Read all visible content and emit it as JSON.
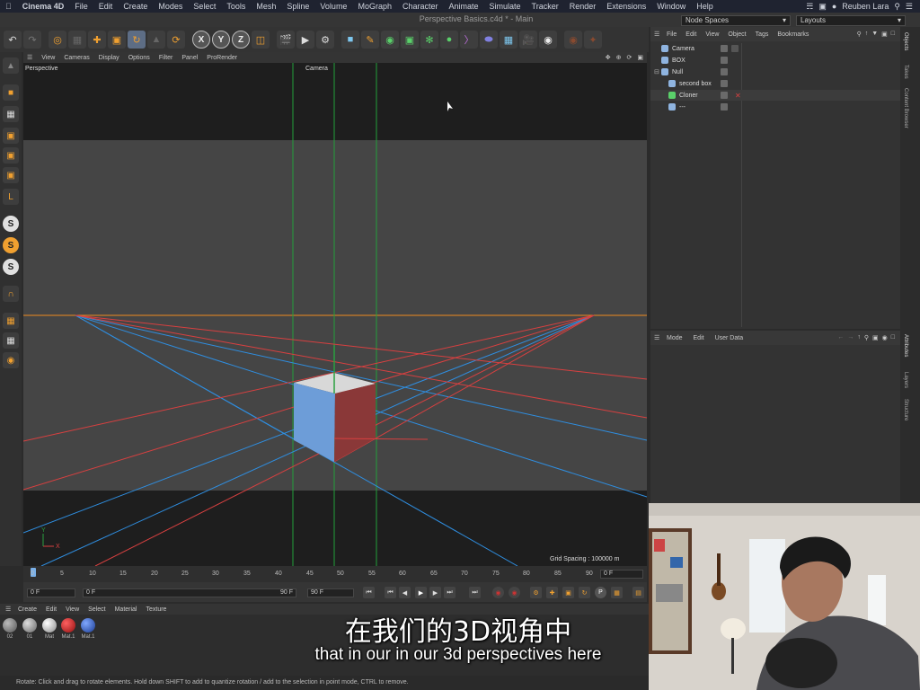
{
  "menubar": {
    "app_name": "Cinema 4D",
    "items": [
      "File",
      "Edit",
      "Create",
      "Modes",
      "Select",
      "Tools",
      "Mesh",
      "Spline",
      "Volume",
      "MoGraph",
      "Character",
      "Animate",
      "Simulate",
      "Tracker",
      "Render",
      "Extensions",
      "Window",
      "Help"
    ],
    "user": "Reuben Lara"
  },
  "window": {
    "title": "Perspective Basics.c4d * - Main",
    "node_spaces": "Node Spaces",
    "layouts": "Layouts"
  },
  "viewport": {
    "menu": [
      "View",
      "Cameras",
      "Display",
      "Options",
      "Filter",
      "Panel",
      "ProRender"
    ],
    "label": "Perspective",
    "camera": "Camera",
    "grid_spacing": "Grid Spacing : 100000 m",
    "axis_y": "Y",
    "axis_x": "X"
  },
  "timeline": {
    "ticks": [
      "0",
      "5",
      "10",
      "15",
      "20",
      "25",
      "30",
      "35",
      "40",
      "45",
      "50",
      "55",
      "60",
      "65",
      "70",
      "75",
      "80",
      "85",
      "90"
    ],
    "current_frame": "0 F"
  },
  "transport": {
    "start": "0 F",
    "current": "0 F",
    "end": "90 F",
    "end2": "90 F"
  },
  "object_manager": {
    "menu": [
      "File",
      "Edit",
      "View",
      "Object",
      "Tags",
      "Bookmarks"
    ],
    "objects": [
      {
        "name": "Camera",
        "indent": 0
      },
      {
        "name": "BOX",
        "indent": 0
      },
      {
        "name": "Null",
        "indent": 0
      },
      {
        "name": "second box",
        "indent": 1
      },
      {
        "name": "Cloner",
        "indent": 1
      },
      {
        "name": "---",
        "indent": 1
      }
    ]
  },
  "attribute_manager": {
    "menu": [
      "Mode",
      "Edit",
      "User Data"
    ]
  },
  "side_tabs": [
    "Objects",
    "Takes",
    "Content Browser",
    "Attributes",
    "Layers",
    "Structure"
  ],
  "material_manager": {
    "menu": [
      "Create",
      "Edit",
      "View",
      "Select",
      "Material",
      "Texture"
    ],
    "materials": [
      {
        "name": "02",
        "color": "#888888"
      },
      {
        "name": "01",
        "color": "#aaaaaa"
      },
      {
        "name": "Mat",
        "color": "#d8d8d8"
      },
      {
        "name": "Mat.1",
        "color": "#d02020"
      },
      {
        "name": "Mat.1",
        "color": "#3060d0"
      }
    ]
  },
  "status": "Rotate: Click and drag to rotate elements. Hold down SHIFT to add to quantize rotation / add to the selection in point mode, CTRL to remove.",
  "subtitles": {
    "chinese": "在我们的3D视角中",
    "english": "that in our in our 3d perspectives here"
  }
}
